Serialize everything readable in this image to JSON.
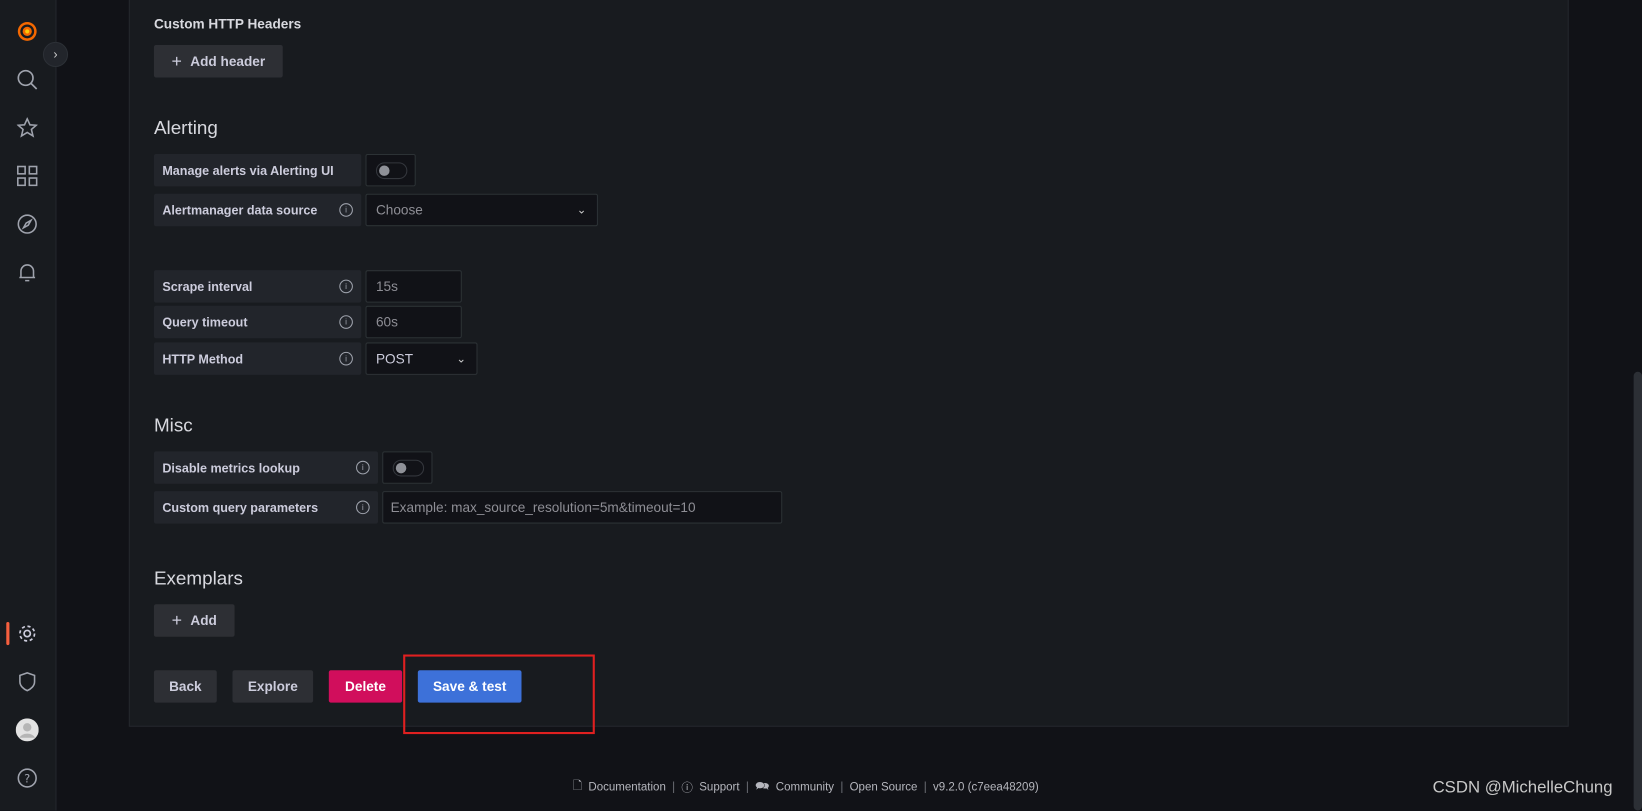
{
  "sidebar": {
    "items": [
      "grafana-logo",
      "search",
      "starred",
      "dashboards",
      "explore",
      "alerting",
      "configuration",
      "server-admin",
      "profile",
      "help"
    ]
  },
  "headers": {
    "title": "Custom HTTP Headers",
    "add_label": "Add header"
  },
  "alerting": {
    "title": "Alerting",
    "manage_label": "Manage alerts via Alerting UI",
    "manage_enabled": false,
    "am_label": "Alertmanager data source",
    "am_placeholder": "Choose"
  },
  "prom": {
    "scrape_label": "Scrape interval",
    "scrape_placeholder": "15s",
    "timeout_label": "Query timeout",
    "timeout_placeholder": "60s",
    "method_label": "HTTP Method",
    "method_value": "POST"
  },
  "misc": {
    "title": "Misc",
    "disable_label": "Disable metrics lookup",
    "disable_enabled": false,
    "custom_label": "Custom query parameters",
    "custom_placeholder": "Example: max_source_resolution=5m&timeout=10"
  },
  "exemplars": {
    "title": "Exemplars",
    "add_label": "Add"
  },
  "actions": {
    "back": "Back",
    "explore": "Explore",
    "delete": "Delete",
    "save": "Save & test"
  },
  "colors": {
    "delete": "#d10e5c",
    "save": "#3d71d9",
    "highlight": "#e02020",
    "accent": "#f55f3e"
  },
  "footer": {
    "documentation": "Documentation",
    "support": "Support",
    "community": "Community",
    "open_source": "Open Source",
    "version": "v9.2.0 (c7eea48209)"
  },
  "watermark": "CSDN @MichelleChung"
}
